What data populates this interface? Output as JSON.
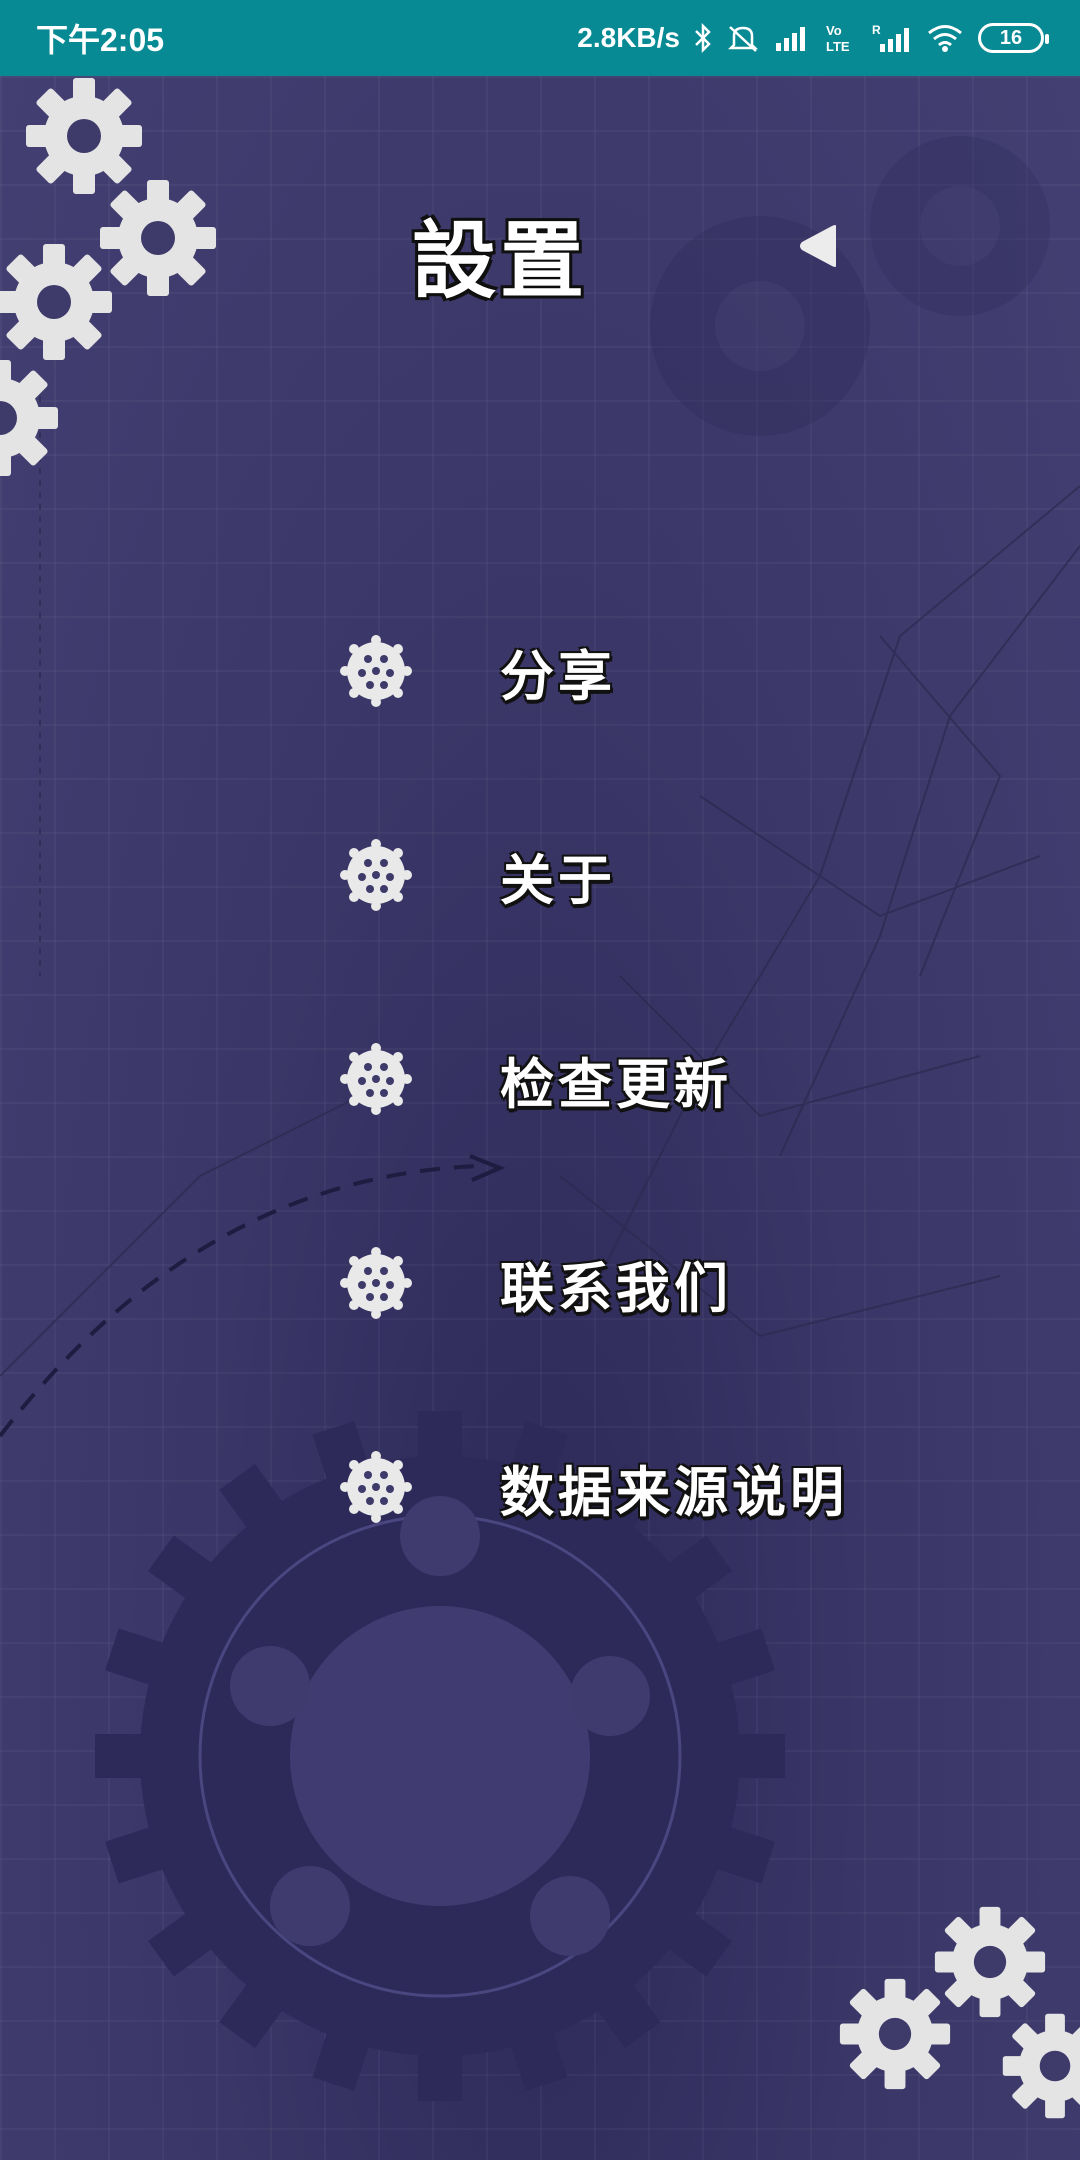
{
  "status_bar": {
    "time": "下午2:05",
    "network_speed": "2.8KB/s",
    "battery_level": "16",
    "icons": [
      "bluetooth-icon",
      "mute-icon",
      "signal-icon",
      "volte-icon",
      "roaming-signal-icon",
      "wifi-icon",
      "battery-icon"
    ]
  },
  "header": {
    "title": "設置",
    "back_icon": "triangle-left-icon"
  },
  "menu": {
    "items": [
      {
        "label": "分享",
        "icon": "dotted-gear-icon"
      },
      {
        "label": "关于",
        "icon": "dotted-gear-icon"
      },
      {
        "label": "检查更新",
        "icon": "dotted-gear-icon"
      },
      {
        "label": "联系我们",
        "icon": "dotted-gear-icon"
      },
      {
        "label": "数据来源说明",
        "icon": "dotted-gear-icon"
      }
    ]
  },
  "colors": {
    "status_bar": "#078a93",
    "background": "#3e3a6a",
    "gear_white": "#e6e6e6",
    "text": "#ffffff"
  }
}
